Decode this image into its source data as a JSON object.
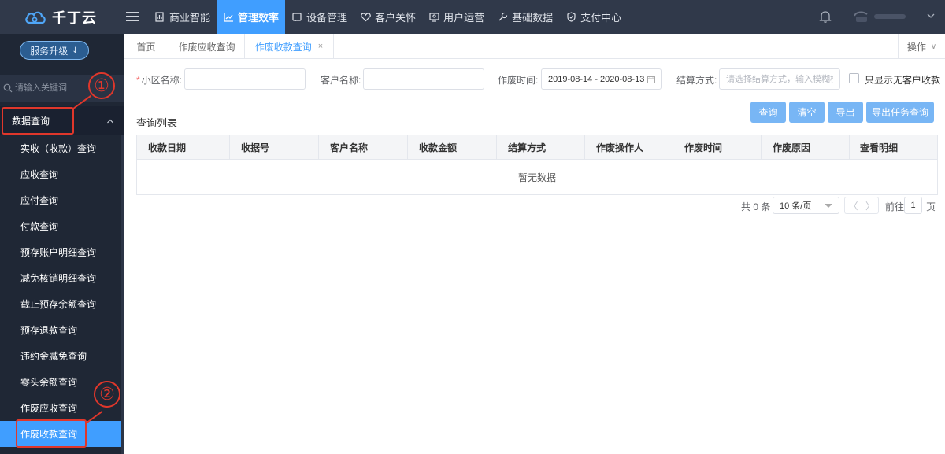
{
  "brand": {
    "name": "千丁云"
  },
  "topnav": [
    {
      "label": "商业智能",
      "icon": "chart-box-icon",
      "active": false
    },
    {
      "label": "管理效率",
      "icon": "trend-chart-icon",
      "active": true
    },
    {
      "label": "设备管理",
      "icon": "device-icon",
      "active": false
    },
    {
      "label": "客户关怀",
      "icon": "heart-icon",
      "active": false
    },
    {
      "label": "用户运营",
      "icon": "user-ops-icon",
      "active": false
    },
    {
      "label": "基础数据",
      "icon": "wrench-icon",
      "active": false
    },
    {
      "label": "支付中心",
      "icon": "shield-icon",
      "active": false
    }
  ],
  "sidebar": {
    "upgrade_label": "服务升级",
    "search_placeholder": "请输入关键词",
    "group_label": "数据查询",
    "items": [
      {
        "label": "实收（收款）查询"
      },
      {
        "label": "应收查询"
      },
      {
        "label": "应付查询"
      },
      {
        "label": "付款查询"
      },
      {
        "label": "预存账户明细查询"
      },
      {
        "label": "减免核销明细查询"
      },
      {
        "label": "截止预存余额查询"
      },
      {
        "label": "预存退款查询"
      },
      {
        "label": "违约金减免查询"
      },
      {
        "label": "零头余额查询"
      },
      {
        "label": "作废应收查询"
      },
      {
        "label": "作废收款查询"
      }
    ],
    "active_index": 11
  },
  "annotations": {
    "one": "①",
    "two": "②"
  },
  "tabs": {
    "items": [
      {
        "label": "首页"
      },
      {
        "label": "作废应收查询"
      },
      {
        "label": "作废收款查询",
        "closable": true
      }
    ],
    "close_glyph": "×",
    "ops_label": "操作"
  },
  "form": {
    "required_mark": "*",
    "community_label": "小区名称:",
    "community_value": "",
    "customer_label": "客户名称:",
    "customer_value": "",
    "void_time_label": "作废时间:",
    "date_range": "2019-08-14 - 2020-08-13",
    "settle_label": "结算方式:",
    "settle_placeholder": "请选择结算方式，输入模糊检索",
    "no_customer_label": "只显示无客户收款",
    "no_customer_checked": false
  },
  "buttons": {
    "query": "查询",
    "clear": "清空",
    "export": "导出",
    "export_tasks": "导出任务查询"
  },
  "list": {
    "title": "查询列表",
    "columns": [
      "收款日期",
      "收据号",
      "客户名称",
      "收款金额",
      "结算方式",
      "作废操作人",
      "作废时间",
      "作废原因",
      "查看明细"
    ],
    "empty_text": "暂无数据"
  },
  "pagination": {
    "total_text": "共 0 条",
    "page_size": "10 条/页",
    "prev": "〈",
    "next": "〉",
    "goto_label": "前往",
    "current_page": "1",
    "page_suffix": "页"
  },
  "colors": {
    "accent": "#409eff",
    "topbar": "#30394a",
    "sidebar": "#1f2735",
    "annotation": "#e0372b"
  }
}
